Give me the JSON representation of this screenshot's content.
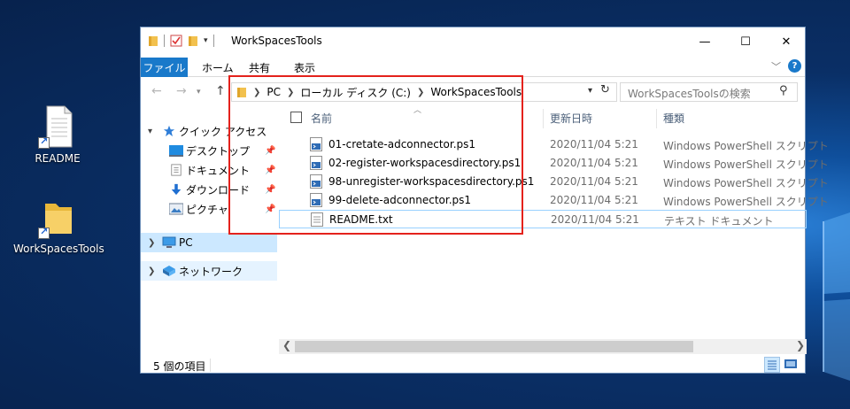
{
  "desktop": {
    "icons": [
      {
        "label": "README",
        "icon": "text-file-shortcut-icon"
      },
      {
        "label": "WorkSpacesTools",
        "icon": "folder-shortcut-icon"
      }
    ]
  },
  "window": {
    "title": "WorkSpacesTools",
    "controls": {
      "minimize": "—",
      "maximize": "☐",
      "close": "✕"
    }
  },
  "ribbon": {
    "file_tab": "ファイル",
    "tabs": [
      "ホーム",
      "共有",
      "表示"
    ],
    "help": "?"
  },
  "navigation": {
    "back": "←",
    "forward": "→",
    "up": "↑",
    "breadcrumb": [
      "PC",
      "ローカル ディスク (C:)",
      "WorkSpacesTools"
    ],
    "search_placeholder": "WorkSpacesToolsの検索"
  },
  "sidebar": {
    "items": [
      {
        "label": "クイック アクセス",
        "icon": "star-icon",
        "pinned": false
      },
      {
        "label": "デスクトップ",
        "icon": "desktop-icon",
        "pinned": true
      },
      {
        "label": "ドキュメント",
        "icon": "document-icon",
        "pinned": true
      },
      {
        "label": "ダウンロード",
        "icon": "download-icon",
        "pinned": true
      },
      {
        "label": "ピクチャ",
        "icon": "pictures-icon",
        "pinned": true
      },
      {
        "label": "PC",
        "icon": "pc-icon",
        "pinned": false
      },
      {
        "label": "ネットワーク",
        "icon": "network-icon",
        "pinned": false
      }
    ]
  },
  "filelist": {
    "columns": {
      "name": "名前",
      "date": "更新日時",
      "type": "種類"
    },
    "files": [
      {
        "name": "01-cretate-adconnector.ps1",
        "date": "2020/11/04 5:21",
        "type": "Windows PowerShell スクリプト",
        "icon": "powershell-script-icon"
      },
      {
        "name": "02-register-workspacesdirectory.ps1",
        "date": "2020/11/04 5:21",
        "type": "Windows PowerShell スクリプト",
        "icon": "powershell-script-icon"
      },
      {
        "name": "98-unregister-workspacesdirectory.ps1",
        "date": "2020/11/04 5:21",
        "type": "Windows PowerShell スクリプト",
        "icon": "powershell-script-icon"
      },
      {
        "name": "99-delete-adconnector.ps1",
        "date": "2020/11/04 5:21",
        "type": "Windows PowerShell スクリプト",
        "icon": "powershell-script-icon"
      },
      {
        "name": "README.txt",
        "date": "2020/11/04 5:21",
        "type": "テキスト ドキュメント",
        "icon": "text-file-icon"
      }
    ]
  },
  "status": {
    "item_count": "5 個の項目"
  },
  "colors": {
    "accent": "#1979ca",
    "highlight": "#e4221c",
    "selection": "#cce8ff"
  }
}
